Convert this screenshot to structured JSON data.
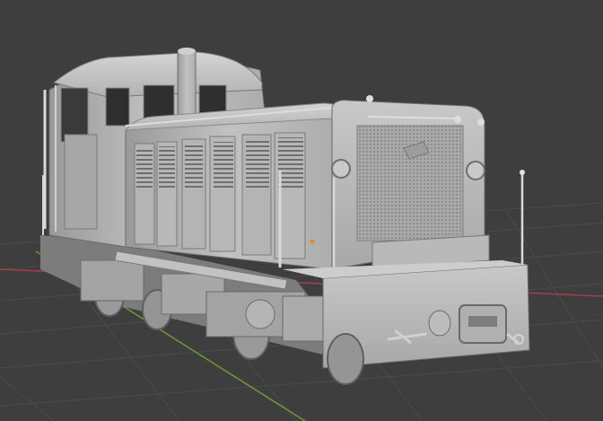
{
  "viewport": {
    "background": "#3e3e3e",
    "grid_color": "#4a4a4a",
    "axis_x_color": "#a3414a",
    "axis_y_color": "#6c9a2e",
    "origin_marker_color": "#e08a2a"
  },
  "model": {
    "object": "diesel-shunter-locomotive",
    "shading": "solid-gray",
    "base_color": "#bdbdbd"
  }
}
